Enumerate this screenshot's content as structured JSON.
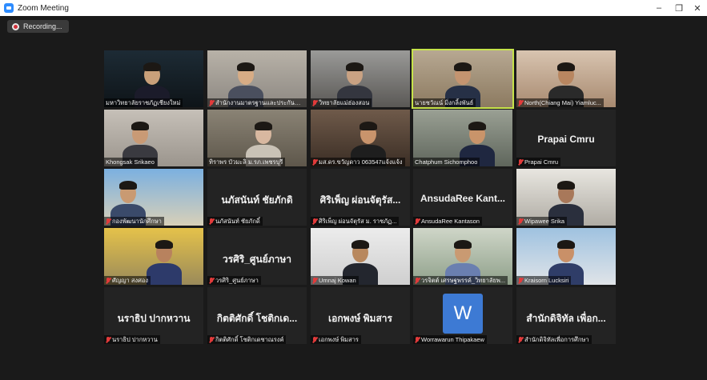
{
  "window": {
    "title": "Zoom Meeting",
    "minimize": "–",
    "maximize": "❐",
    "close": "✕"
  },
  "recording": {
    "label": "Recording..."
  },
  "colors": {
    "background": "#1a1a1a",
    "tile": "#232323",
    "active_speaker": "#c6e34a",
    "muted_mic": "#e23b3b",
    "avatar_blue": "#3d7ad4"
  },
  "participants": [
    {
      "name": "มหาวิทยาลัยราชภัฏเชียงใหม่",
      "video": true,
      "muted": false
    },
    {
      "name": "สำนักงานมาตรฐานและประกันคุณ...",
      "video": true,
      "muted": true
    },
    {
      "name": "วิทยาลัยแม่ฮ่องสอน",
      "video": true,
      "muted": true
    },
    {
      "name": "นายชวัณน์ มิ่งกลิ้งพันธ์",
      "video": true,
      "muted": false,
      "active": true
    },
    {
      "name": "North(Chiang Mai) Yiamluc...",
      "video": true,
      "muted": true
    },
    {
      "name": "Khongsak Srikaeo",
      "video": true,
      "muted": false
    },
    {
      "name": "ทิราพร บัวมะลิ ม.รภ.เพชรบุรี",
      "video": true,
      "muted": false
    },
    {
      "name": "มส.ดร.ขวัญดาว 063547แจ้งแจ้ง",
      "video": true,
      "muted": true
    },
    {
      "name": "Chatphum Sichomphoo",
      "video": true,
      "muted": false
    },
    {
      "name": "Prapai Cmru",
      "video": false,
      "muted": true,
      "display": "Prapai Cmru"
    },
    {
      "name": "กองพัฒนานักศึกษา",
      "video": true,
      "muted": true
    },
    {
      "name": "นภัสนันท์ ชัยภักดิ์",
      "video": false,
      "muted": true,
      "display": "นภัสนันท์ ชัยภักดิ"
    },
    {
      "name": "ศิริเพ็ญ ผ่อนจัตุรัส ม. ราชภัฏ...",
      "video": false,
      "muted": true,
      "display": "ศิริเพ็ญ ผ่อนจัตุรัส..."
    },
    {
      "name": "AnsudaRee Kantason",
      "video": false,
      "muted": true,
      "display": "AnsudaRee Kant..."
    },
    {
      "name": "Wipawee Srika",
      "video": true,
      "muted": true
    },
    {
      "name": "ศัญญา สงศอง",
      "video": true,
      "muted": true
    },
    {
      "name": "วรศิริ_ศูนย์ภาษา",
      "video": false,
      "muted": true,
      "display": "วรศิริ_ศูนย์ภาษา"
    },
    {
      "name": "Umnaj Kowan",
      "video": true,
      "muted": true
    },
    {
      "name": "วรจิตต์ เศรษฐพรรค์_วิทยาลัยพ...",
      "video": true,
      "muted": true
    },
    {
      "name": "Kraisorn Lucksiri",
      "video": true,
      "muted": true
    },
    {
      "name": "นราธิป ปากหวาน",
      "video": false,
      "muted": true,
      "display": "นราธิป ปากหวาน"
    },
    {
      "name": "กิตติศักดิ์ โชติกเดชาณรงค์",
      "video": false,
      "muted": true,
      "display": "กิตติศักดิ์ โชติกเด..."
    },
    {
      "name": "เอกพงษ์ พิมสาร",
      "video": false,
      "muted": true,
      "display": "เอกพงษ์ พิมสาร"
    },
    {
      "name": "Worrawarun Thipakaew",
      "video": false,
      "muted": true,
      "avatar": "W"
    },
    {
      "name": "สำนักดิจิทัลเพื่อการศึกษา",
      "video": false,
      "muted": true,
      "display": "สำนักดิจิทัล เพื่อก..."
    }
  ]
}
